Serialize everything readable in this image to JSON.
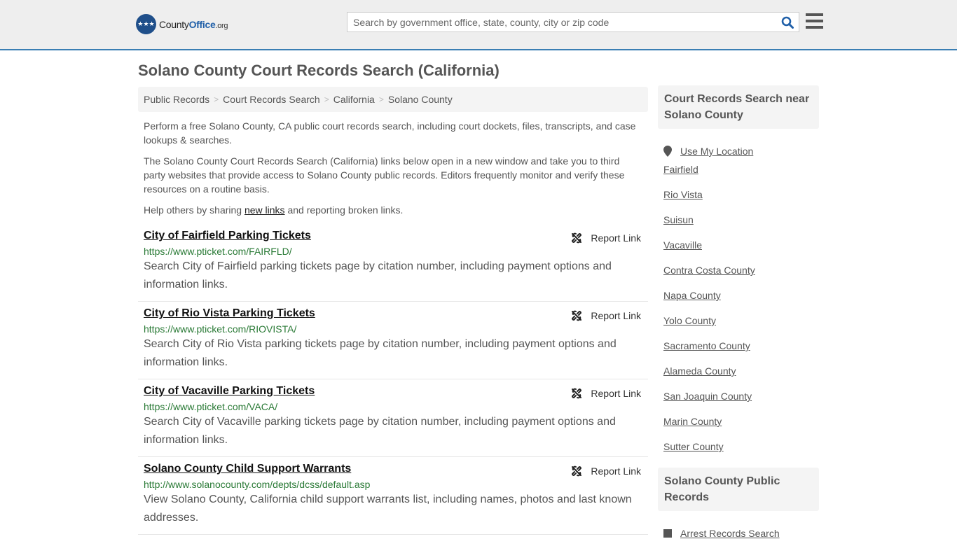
{
  "header": {
    "logo_text": "County",
    "logo_bold": "Office",
    "logo_tld": ".org",
    "search_placeholder": "Search by government office, state, county, city or zip code"
  },
  "page_title": "Solano County Court Records Search (California)",
  "breadcrumb": [
    "Public Records",
    "Court Records Search",
    "California",
    "Solano County"
  ],
  "intro": {
    "p1": "Perform a free Solano County, CA public court records search, including court dockets, files, transcripts, and case lookups & searches.",
    "p2": "The Solano County Court Records Search (California) links below open in a new window and take you to third party websites that provide access to Solano County public records. Editors frequently monitor and verify these resources on a routine basis.",
    "p3_before": "Help others by sharing ",
    "p3_link": "new links",
    "p3_after": " and reporting broken links."
  },
  "report_label": "Report Link",
  "listings": [
    {
      "title": "City of Fairfield Parking Tickets",
      "url": "https://www.pticket.com/FAIRFLD/",
      "desc": "Search City of Fairfield parking tickets page by citation number, including payment options and information links."
    },
    {
      "title": "City of Rio Vista Parking Tickets",
      "url": "https://www.pticket.com/RIOVISTA/",
      "desc": "Search City of Rio Vista parking tickets page by citation number, including payment options and information links."
    },
    {
      "title": "City of Vacaville Parking Tickets",
      "url": "https://www.pticket.com/VACA/",
      "desc": "Search City of Vacaville parking tickets page by citation number, including payment options and information links."
    },
    {
      "title": "Solano County Child Support Warrants",
      "url": "http://www.solanocounty.com/depts/dcss/default.asp",
      "desc": "View Solano County, California child support warrants list, including names, photos and last known addresses."
    }
  ],
  "sidebar": {
    "heading1": "Court Records Search near Solano County",
    "use_location": "Use My Location",
    "nearby": [
      "Fairfield",
      "Rio Vista",
      "Suisun",
      "Vacaville",
      "Contra Costa County",
      "Napa County",
      "Yolo County",
      "Sacramento County",
      "Alameda County",
      "San Joaquin County",
      "Marin County",
      "Sutter County"
    ],
    "heading2": "Solano County Public Records",
    "records": [
      "Arrest Records Search"
    ]
  }
}
